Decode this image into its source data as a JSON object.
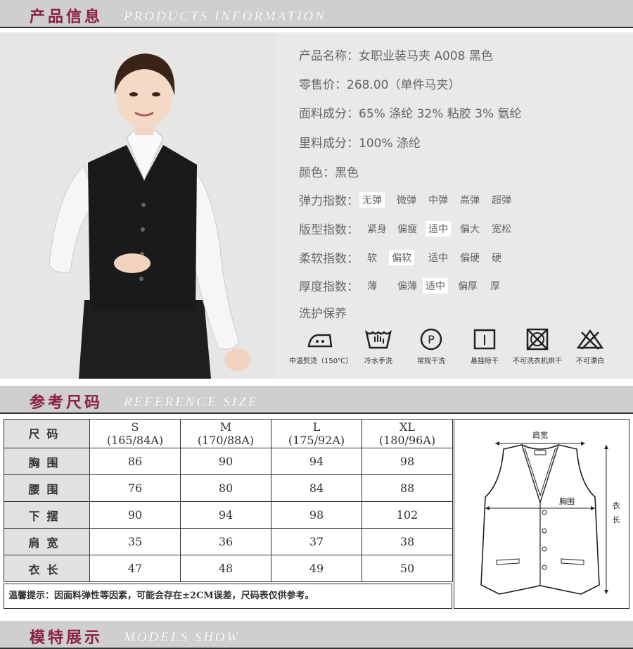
{
  "section1": {
    "cn": "产品信息",
    "en": "PRODUCTS  INFORMATION"
  },
  "section2": {
    "cn": "参考尺码",
    "en": "REFERENCE  SIZE"
  },
  "section3": {
    "cn": "模特展示",
    "en": "MODELS  SHOW"
  },
  "product": {
    "name": "产品名称：女职业装马夹 A008 黑色",
    "price": "零售价：268.00（单件马夹）",
    "fabric": "面料成分：65% 涤纶 32% 粘胶 3% 氨纶",
    "lining": "里料成分：100% 涤纶",
    "color": "颜色：黑色",
    "care_title": "洗护保养"
  },
  "indices": [
    {
      "label": "弹力指数：",
      "options": [
        "无弹",
        "微弹",
        "中弹",
        "高弹",
        "超弹"
      ],
      "selected": 0
    },
    {
      "label": "版型指数：",
      "options": [
        "紧身",
        "偏瘦",
        "适中",
        "偏大",
        "宽松"
      ],
      "selected": 2
    },
    {
      "label": "柔软指数：",
      "options": [
        "软",
        "偏软",
        "适中",
        "偏硬",
        "硬"
      ],
      "selected": 1
    },
    {
      "label": "厚度指数：",
      "options": [
        "薄",
        "偏薄",
        "适中",
        "偏厚",
        "厚"
      ],
      "selected": 2
    }
  ],
  "care": [
    {
      "icon": "iron-icon",
      "label": "中温熨烫（150℃）"
    },
    {
      "icon": "hand-wash-icon",
      "label": "冷水手洗"
    },
    {
      "icon": "dry-clean-p-icon",
      "label": "常规干洗"
    },
    {
      "icon": "hang-dry-icon",
      "label": "悬挂晾干"
    },
    {
      "icon": "no-tumble-dry-icon",
      "label": "不可洗衣机烘干"
    },
    {
      "icon": "no-bleach-icon",
      "label": "不可漂白"
    }
  ],
  "size_table": {
    "header_label": "尺码",
    "sizes": [
      {
        "size": "S",
        "spec": "(165/84A)"
      },
      {
        "size": "M",
        "spec": "(170/88A)"
      },
      {
        "size": "L",
        "spec": "(175/92A)"
      },
      {
        "size": "XL",
        "spec": "(180/96A)"
      }
    ],
    "rows": [
      {
        "label": "胸围",
        "values": [
          "86",
          "90",
          "94",
          "98"
        ]
      },
      {
        "label": "腰围",
        "values": [
          "76",
          "80",
          "84",
          "88"
        ]
      },
      {
        "label": "下摆",
        "values": [
          "90",
          "94",
          "98",
          "102"
        ]
      },
      {
        "label": "肩宽",
        "values": [
          "35",
          "36",
          "37",
          "38"
        ]
      },
      {
        "label": "衣长",
        "values": [
          "47",
          "48",
          "49",
          "50"
        ]
      }
    ],
    "note": "温馨提示：因面料弹性等因素，可能会存在±2CM误差，尺码表仅供参考。"
  },
  "diagram": {
    "shoulder": "肩宽",
    "chest": "胸围",
    "length_1": "衣",
    "length_2": "长"
  }
}
